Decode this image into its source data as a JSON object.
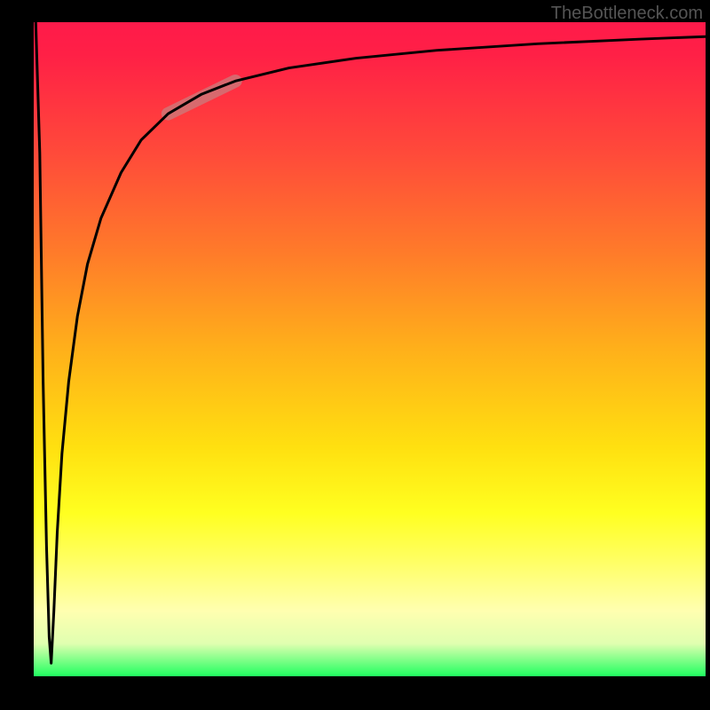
{
  "attribution": "TheBottleneck.com",
  "chart_data": {
    "type": "line",
    "title": "",
    "xlabel": "",
    "ylabel": "",
    "legend": false,
    "grid": false,
    "xlim": [
      0,
      100
    ],
    "ylim": [
      0,
      100
    ],
    "background": {
      "type": "vertical-gradient",
      "stops": [
        {
          "pos": 0.0,
          "color": "#ff1a4a"
        },
        {
          "pos": 0.35,
          "color": "#ff7a2a"
        },
        {
          "pos": 0.65,
          "color": "#ffe010"
        },
        {
          "pos": 0.9,
          "color": "#ffffb0"
        },
        {
          "pos": 1.0,
          "color": "#20ff60"
        }
      ]
    },
    "series": [
      {
        "name": "bottleneck-curve-down",
        "x": [
          0,
          0.5,
          1.0,
          1.5,
          2.0,
          2.5
        ],
        "values": [
          100,
          80,
          45,
          20,
          6,
          2
        ],
        "stroke": "#000000",
        "width": 3
      },
      {
        "name": "bottleneck-curve-up",
        "x": [
          2.5,
          3,
          4,
          5,
          7,
          10,
          14,
          18,
          22,
          28,
          35,
          45,
          60,
          80,
          100
        ],
        "values": [
          2,
          10,
          28,
          42,
          58,
          70,
          79,
          84,
          88,
          91,
          93,
          95,
          96.5,
          97.5,
          98
        ],
        "stroke": "#000000",
        "width": 3
      }
    ],
    "annotations": [
      {
        "name": "highlight-segment",
        "type": "line-segment",
        "x0": 20,
        "y0": 86,
        "x1": 30,
        "y1": 91,
        "stroke": "#c88080",
        "width": 14,
        "opacity": 0.7,
        "linecap": "round"
      }
    ],
    "frame_color": "#000000"
  }
}
